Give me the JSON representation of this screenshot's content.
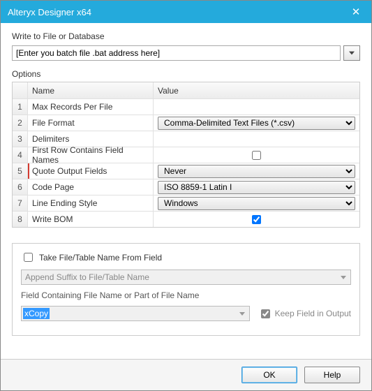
{
  "titlebar": {
    "title": "Alteryx Designer x64"
  },
  "file": {
    "label": "Write to File or Database",
    "value": "[Enter you batch file .bat address here]"
  },
  "options": {
    "label": "Options",
    "headers": {
      "name": "Name",
      "value": "Value"
    },
    "rows": [
      {
        "idx": "1",
        "name": "Max Records Per File",
        "type": "text",
        "value": ""
      },
      {
        "idx": "2",
        "name": "File Format",
        "type": "select",
        "value": "Comma-Delimited Text Files (*.csv)"
      },
      {
        "idx": "3",
        "name": "Delimiters",
        "type": "text",
        "value": ""
      },
      {
        "idx": "4",
        "name": "First Row Contains Field Names",
        "type": "check",
        "checked": false
      },
      {
        "idx": "5",
        "name": "Quote Output Fields",
        "type": "select",
        "value": "Never",
        "flag": true
      },
      {
        "idx": "6",
        "name": "Code Page",
        "type": "select",
        "value": "ISO 8859-1 Latin I"
      },
      {
        "idx": "7",
        "name": "Line Ending Style",
        "type": "select",
        "value": "Windows"
      },
      {
        "idx": "8",
        "name": "Write BOM",
        "type": "check",
        "checked": true
      }
    ]
  },
  "panel": {
    "take_label": "Take File/Table Name From Field",
    "take_checked": false,
    "mode_value": "Append Suffix to File/Table Name",
    "field_label": "Field Containing File Name or Part of File Name",
    "field_value": "xCopy",
    "keep_label": "Keep Field in Output",
    "keep_checked": true
  },
  "footer": {
    "ok": "OK",
    "help": "Help"
  }
}
